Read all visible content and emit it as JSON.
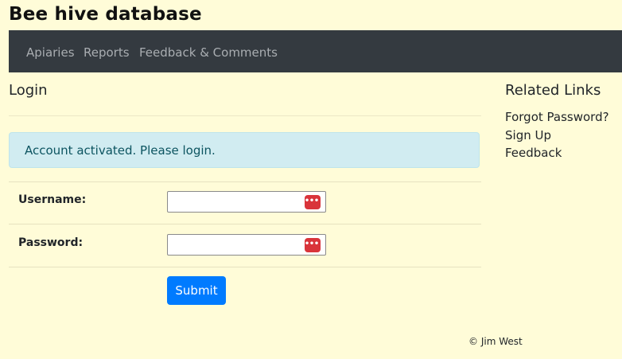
{
  "site": {
    "title": "Bee hive database"
  },
  "nav": {
    "items": [
      {
        "label": "Apiaries"
      },
      {
        "label": "Reports"
      },
      {
        "label": "Feedback & Comments"
      }
    ]
  },
  "main": {
    "heading": "Login",
    "alert": "Account activated. Please login.",
    "form": {
      "username_label": "Username:",
      "username_value": "",
      "password_label": "Password:",
      "password_value": "",
      "submit_label": "Submit"
    }
  },
  "sidebar": {
    "heading": "Related Links",
    "links": [
      {
        "label": "Forgot Password?"
      },
      {
        "label": "Sign Up"
      },
      {
        "label": "Feedback"
      }
    ]
  },
  "footer": {
    "text": "© Jim West"
  },
  "icons": {
    "password_manager": "password-manager-icon"
  },
  "colors": {
    "page_bg": "#fffcd8",
    "navbar_bg": "#343a40",
    "alert_bg": "#d1ecf1",
    "alert_text": "#0c5460",
    "button_bg": "#007bff",
    "password_icon": "#d9343a"
  }
}
